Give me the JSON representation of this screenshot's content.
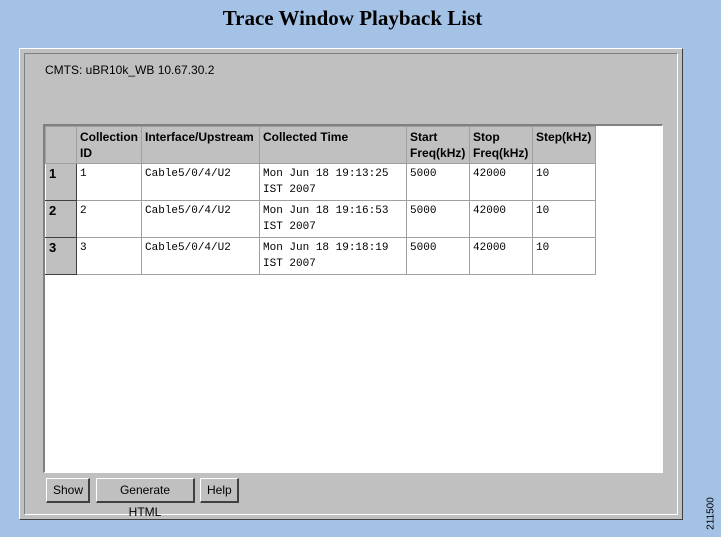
{
  "page": {
    "title": "Trace Window Playback List",
    "figure_id": "211500"
  },
  "cmts": {
    "label": "CMTS: uBR10k_WB 10.67.30.2"
  },
  "table": {
    "columns": [
      "Collection ID",
      "Interface/Upstream",
      "Collected Time",
      "Start Freq(kHz)",
      "Stop Freq(kHz)",
      "Step(kHz)"
    ],
    "rows": [
      {
        "row_number": "1",
        "collection_id": "1",
        "interface_upstream": "Cable5/0/4/U2",
        "collected_time": "Mon Jun 18 19:13:25 IST 2007",
        "start_freq": "5000",
        "stop_freq": "42000",
        "step": "10"
      },
      {
        "row_number": "2",
        "collection_id": "2",
        "interface_upstream": "Cable5/0/4/U2",
        "collected_time": "Mon Jun 18 19:16:53 IST 2007",
        "start_freq": "5000",
        "stop_freq": "42000",
        "step": "10"
      },
      {
        "row_number": "3",
        "collection_id": "3",
        "interface_upstream": "Cable5/0/4/U2",
        "collected_time": "Mon Jun 18 19:18:19 IST 2007",
        "start_freq": "5000",
        "stop_freq": "42000",
        "step": "10"
      }
    ]
  },
  "buttons": {
    "show": "Show",
    "generate_html": "Generate HTML",
    "help": "Help"
  },
  "colors": {
    "background": "#a4c2e6",
    "window": "#c0c0c0",
    "table_background": "#ffffff"
  }
}
